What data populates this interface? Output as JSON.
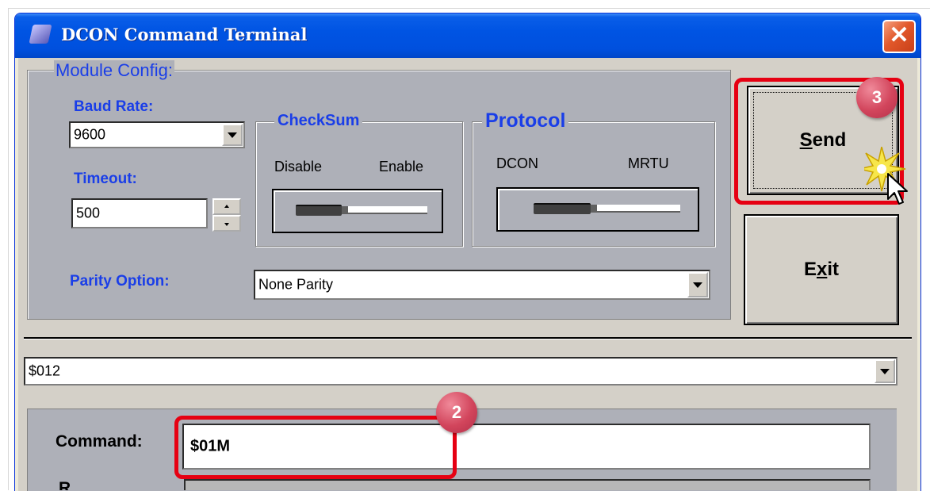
{
  "window": {
    "title": "DCON Command Terminal",
    "close_label": "✕"
  },
  "module_config": {
    "legend": "Module Config:",
    "baud_rate": {
      "label": "Baud Rate:",
      "value": "9600"
    },
    "timeout": {
      "label": "Timeout:",
      "value": "500"
    },
    "checksum": {
      "legend": "CheckSum",
      "left_label": "Disable",
      "right_label": "Enable",
      "position": "Disable"
    },
    "protocol": {
      "legend": "Protocol",
      "left_label": "DCON",
      "right_label": "MRTU",
      "position": "DCON"
    },
    "parity": {
      "label": "Parity Option:",
      "value": "None Parity"
    }
  },
  "buttons": {
    "send_prefix": "S",
    "send_rest": "end",
    "exit_prefix": "E",
    "exit_underlined": "x",
    "exit_rest": "it"
  },
  "history_combo": {
    "value": "$012"
  },
  "command": {
    "label": "Command:",
    "value": "$01M"
  },
  "response": {
    "label_partial": "R"
  },
  "annotations": {
    "step_send": "3",
    "step_command": "2",
    "highlight_color": "#e60012"
  },
  "colors": {
    "title_bar": "#0054e3",
    "panel": "#aeb0b8",
    "label_blue": "#1a3ee8",
    "close_button": "#e2582a"
  }
}
